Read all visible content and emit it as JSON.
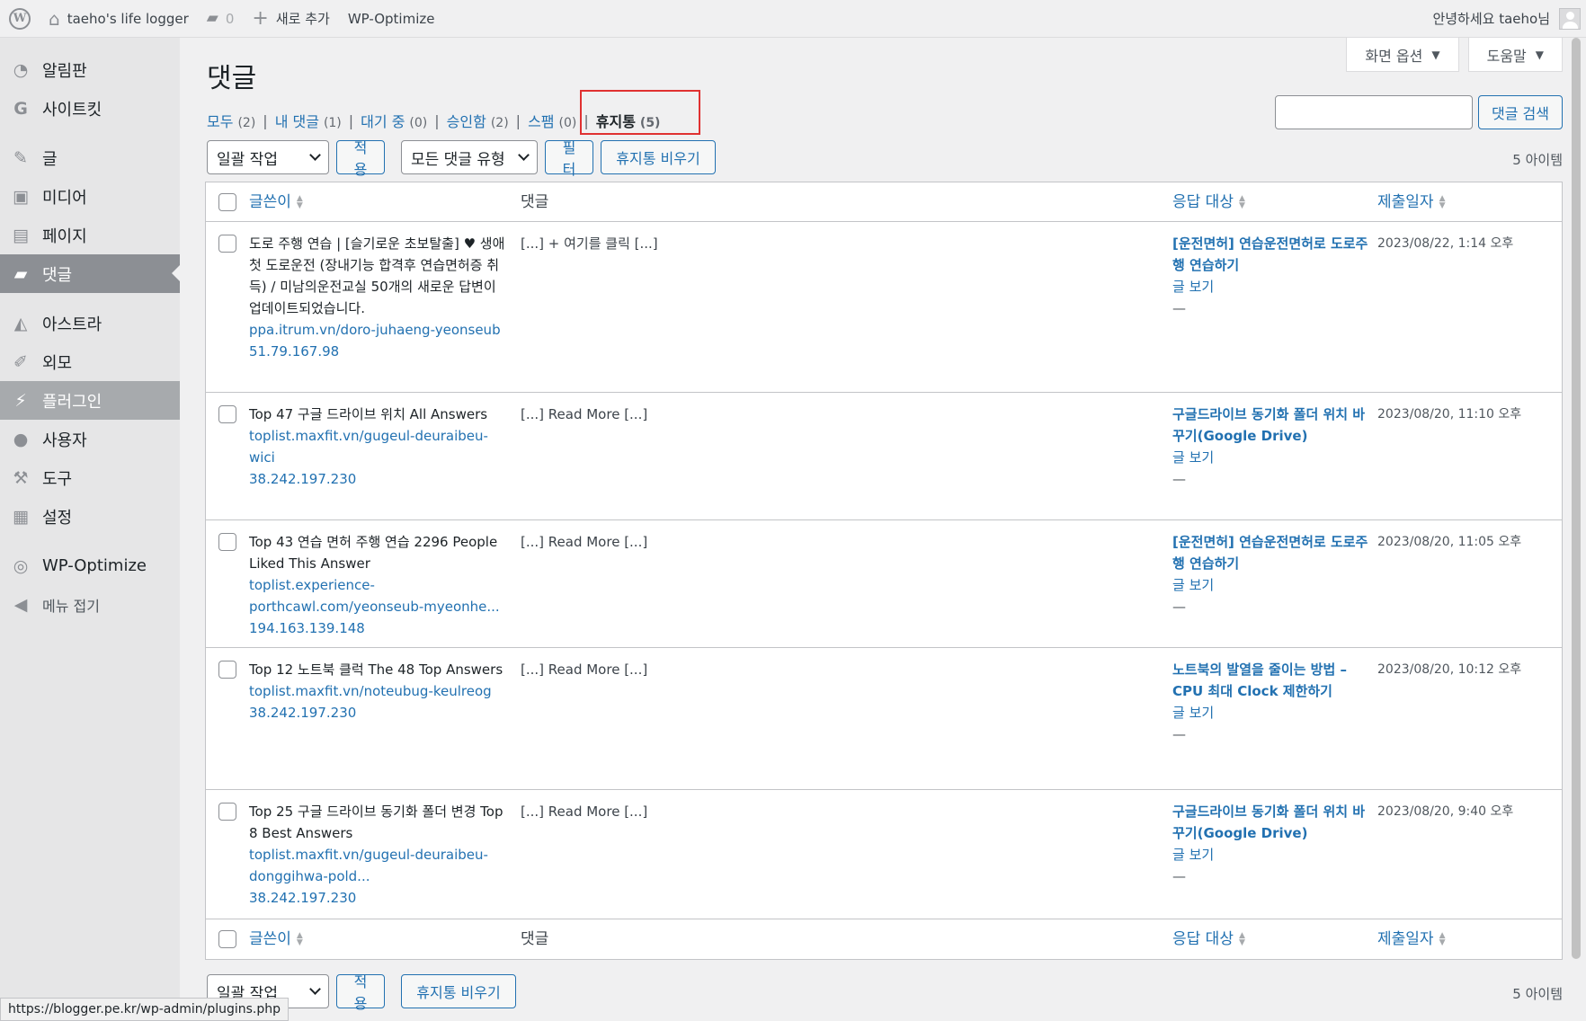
{
  "adminbar": {
    "site_name": "taeho's life logger",
    "comments_count": "0",
    "new_label": "새로 추가",
    "plugin_label": "WP-Optimize",
    "greeting": "안녕하세요 taeho님"
  },
  "sidebar": {
    "items": [
      {
        "label": "알림판",
        "icon": "dashboard-icon"
      },
      {
        "label": "사이트킷",
        "icon": "sitekit-icon"
      },
      {
        "label": "글",
        "icon": "pin-icon"
      },
      {
        "label": "미디어",
        "icon": "media-icon"
      },
      {
        "label": "페이지",
        "icon": "page-icon"
      },
      {
        "label": "댓글",
        "icon": "comment-icon"
      },
      {
        "label": "아스트라",
        "icon": "astra-icon"
      },
      {
        "label": "외모",
        "icon": "brush-icon"
      },
      {
        "label": "플러그인",
        "icon": "plugin-icon"
      },
      {
        "label": "사용자",
        "icon": "user-icon"
      },
      {
        "label": "도구",
        "icon": "wrench-icon"
      },
      {
        "label": "설정",
        "icon": "settings-icon"
      },
      {
        "label": "WP-Optimize",
        "icon": "wpoptimize-icon"
      },
      {
        "label": "메뉴 접기",
        "icon": "collapse-icon"
      }
    ]
  },
  "screen_options": {
    "screen_label": "화면 옵션",
    "help_label": "도움말"
  },
  "page_title": "댓글",
  "filters": {
    "all": {
      "label": "모두",
      "count": "(2)"
    },
    "mine": {
      "label": "내 댓글",
      "count": "(1)"
    },
    "pending": {
      "label": "대기 중",
      "count": "(0)"
    },
    "approved": {
      "label": "승인함",
      "count": "(2)"
    },
    "spam": {
      "label": "스팸",
      "count": "(0)"
    },
    "trash": {
      "label": "휴지통",
      "count": "(5)"
    },
    "separator": "|"
  },
  "search": {
    "button_label": "댓글 검색",
    "value": ""
  },
  "tablenav": {
    "bulk_action": "일괄 작업",
    "apply": "적용",
    "comment_type": "모든 댓글 유형",
    "filter": "필터",
    "empty_trash": "휴지통 비우기",
    "items_count": "5 아이템"
  },
  "table": {
    "headers": {
      "author": "글쓴이",
      "comment": "댓글",
      "response": "응답 대상",
      "date": "제출일자"
    },
    "rows": [
      {
        "author": "도로 주행 연습 | [슬기로운 초보탈출] ♥ 생애 첫 도로운전 (장내기능 합격후 연습면허증 취득) / 미남의운전교실 50개의 새로운 답변이 업데이트되었습니다.",
        "url": "ppa.itrum.vn/doro-juhaeng-yeonseub",
        "ip": "51.79.167.98",
        "comment": "[...] + 여기를 클릭 [...]",
        "response": "[운전면허] 연습운전면허로 도로주행 연습하기",
        "view": "글 보기",
        "dash": "—",
        "date": "2023/08/22, 1:14 오후"
      },
      {
        "author": "Top 47 구글 드라이브 위치 All Answers",
        "url": "toplist.maxfit.vn/gugeul-deuraibeu-wici",
        "ip": "38.242.197.230",
        "comment": "[...] Read More [...]",
        "response": "구글드라이브 동기화 폴더 위치 바꾸기(Google Drive)",
        "view": "글 보기",
        "dash": "—",
        "date": "2023/08/20, 11:10 오후"
      },
      {
        "author": "Top 43 연습 면허 주행 연습 2296 People Liked This Answer",
        "url": "toplist.experience-porthcawl.com/yeonseub-myeonhe...",
        "ip": "194.163.139.148",
        "comment": "[...] Read More [...]",
        "response": "[운전면허] 연습운전면허로 도로주행 연습하기",
        "view": "글 보기",
        "dash": "—",
        "date": "2023/08/20, 11:05 오후"
      },
      {
        "author": "Top 12 노트북 클럭 The 48 Top Answers",
        "url": "toplist.maxfit.vn/noteubug-keulreog",
        "ip": "38.242.197.230",
        "comment": "[...] Read More [...]",
        "response": "노트북의 발열을 줄이는 방법 – CPU 최대 Clock 제한하기",
        "view": "글 보기",
        "dash": "—",
        "date": "2023/08/20, 10:12 오후"
      },
      {
        "author": "Top 25 구글 드라이브 동기화 폴더 변경 Top 8 Best Answers",
        "url": "toplist.maxfit.vn/gugeul-deuraibeu-donggihwa-pold...",
        "ip": "38.242.197.230",
        "comment": "[...] Read More [...]",
        "response": "구글드라이브 동기화 폴더 위치 바꾸기(Google Drive)",
        "view": "글 보기",
        "dash": "—",
        "date": "2023/08/20, 9:40 오후"
      }
    ]
  },
  "status_url": "https://blogger.pe.kr/wp-admin/plugins.php"
}
